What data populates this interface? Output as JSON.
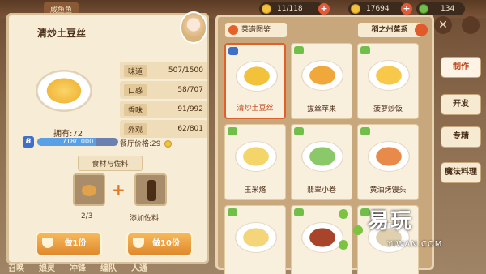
{
  "topbar": {
    "fish_label": "咸鱼鱼",
    "energy": "11/118",
    "coins": "17694",
    "gems": "134"
  },
  "detail": {
    "title": "清炒土豆丝",
    "owned": "拥有:72",
    "level_badge": "B",
    "exp": "718/1000",
    "exp_fraction": 0.718,
    "stats": [
      {
        "label": "味道",
        "value": "507/1500"
      },
      {
        "label": "口感",
        "value": "58/707"
      },
      {
        "label": "香味",
        "value": "91/992"
      },
      {
        "label": "外观",
        "value": "62/801"
      }
    ],
    "price_label": "餐厅价格:29",
    "ingredients_label": "食材与佐料",
    "ingredient_count": "2/3",
    "add_seasoning": "添加佐料",
    "cook_button": "做1份",
    "cook_many_button": "做10份"
  },
  "recipes": {
    "search_button": "菜谱图鉴",
    "region_button": "稻之州菜系",
    "items": [
      {
        "name": "清炒土豆丝",
        "tag": "blue",
        "color": "#f2c23a",
        "selected": true
      },
      {
        "name": "拔丝苹果",
        "tag": "green",
        "color": "#f0a83a",
        "selected": false
      },
      {
        "name": "菠萝炒饭",
        "tag": "green",
        "color": "#f7c84a",
        "selected": false
      },
      {
        "name": "玉米烙",
        "tag": "green",
        "color": "#f3d56a",
        "selected": false
      },
      {
        "name": "翡翠小卷",
        "tag": "green",
        "color": "#8ac86a",
        "selected": false
      },
      {
        "name": "黄油烤馒头",
        "tag": "green",
        "color": "#e88a4a",
        "selected": false
      },
      {
        "name": "",
        "tag": "green",
        "color": "#f5d57a",
        "selected": false
      },
      {
        "name": "",
        "tag": "green",
        "color": "#a8442a",
        "selected": false
      },
      {
        "name": "",
        "tag": "green",
        "color": "#e0d0b0",
        "selected": false
      }
    ]
  },
  "side_tabs": [
    {
      "label": "制作",
      "active": true
    },
    {
      "label": "开发",
      "active": false
    },
    {
      "label": "专精",
      "active": false
    },
    {
      "label": "魔法料理",
      "active": false
    }
  ],
  "bottom_nav": [
    "召唤",
    "娘灵",
    "冲锋",
    "编队",
    "人通"
  ],
  "watermark": {
    "logo": "易玩",
    "sub": "YIWAN.COM"
  }
}
